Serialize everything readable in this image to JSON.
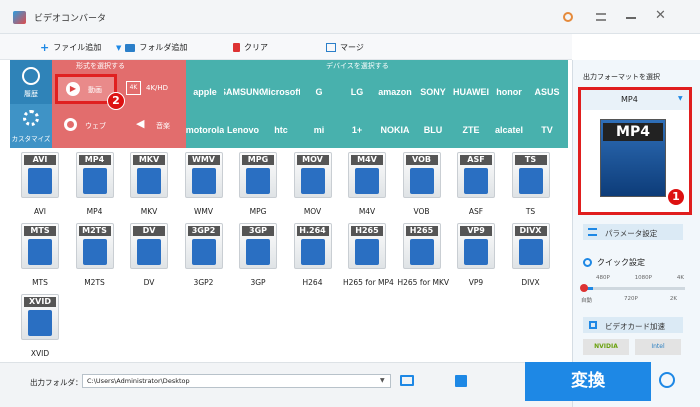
{
  "window": {
    "title": "ビデオコンバータ"
  },
  "toolbar": {
    "add_file": "ファイル追加",
    "add_folder": "フォルダ追加",
    "clear": "クリア",
    "merge": "マージ"
  },
  "left_categories": {
    "history": "履歴",
    "custom": "カスタマイズ"
  },
  "format_header": "形式を選択する",
  "device_header": "デバイスを選択する",
  "categories": {
    "video": "動画",
    "hd": "4K/HD",
    "web": "ウェブ",
    "audio": "音楽"
  },
  "devices": [
    "apple",
    "SAMSUNG",
    "Microsoft",
    "G",
    "LG",
    "amazon",
    "SONY",
    "HUAWEI",
    "honor",
    "ASUS",
    "motorola",
    "Lenovo",
    "htc",
    "mi",
    "1+",
    "NOKIA",
    "BLU",
    "ZTE",
    "alcatel",
    "TV"
  ],
  "formats_row1": [
    "AVI",
    "MP4",
    "MKV",
    "WMV",
    "MPG",
    "MOV",
    "M4V",
    "VOB",
    "ASF",
    "TS"
  ],
  "formats_row2": [
    "MTS",
    "M2TS",
    "DV",
    "3GP2",
    "3GP",
    "H264",
    "H265 for MP4",
    "H265 for MKV",
    "VP9",
    "DIVX"
  ],
  "formats_row2_tags": [
    "MTS",
    "M2TS",
    "DV",
    "3GP2",
    "3GP",
    "H.264",
    "H265",
    "H265",
    "VP9",
    "DIVX"
  ],
  "formats_row3": [
    "XVID"
  ],
  "right_panel": {
    "title": "出力フォーマットを選択",
    "selected_format": "MP4",
    "format_badge": "MP4",
    "params_button": "パラメータ設定",
    "quick_settings": "クイック設定",
    "scale_top": [
      "480P",
      "1080P",
      "4K"
    ],
    "scale_bottom": [
      "自動",
      "720P",
      "2K"
    ],
    "gpu_button": "ビデオカード加速",
    "gpu_nvidia": "NVIDIA",
    "gpu_intel": "Intel"
  },
  "bottom": {
    "output_folder_label": "出力フォルダ：",
    "output_path": "C:\\Users\\Administrator\\Desktop",
    "convert_button": "変換"
  },
  "markers": {
    "one": "1",
    "two": "2"
  },
  "colors": {
    "accent": "#1e88e5",
    "marker": "#dd1111",
    "device_bg": "#48b1ad",
    "category_bg": "#e26d6d"
  }
}
